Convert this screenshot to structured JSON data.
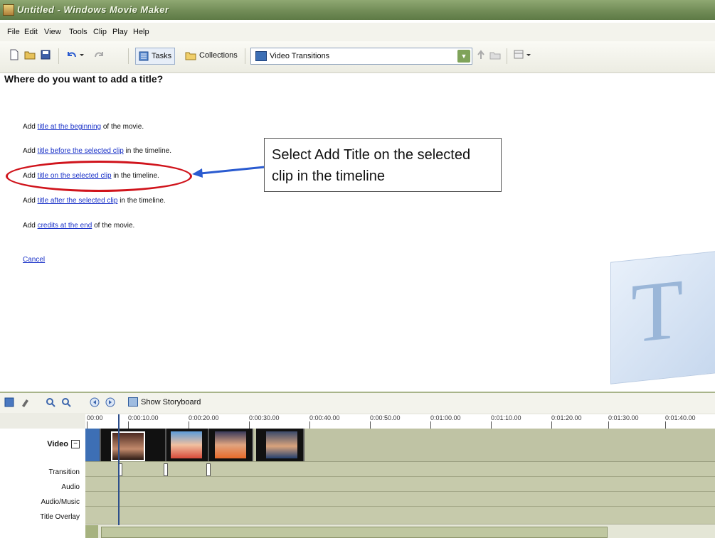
{
  "window": {
    "title": "Untitled - Windows Movie Maker"
  },
  "menu": [
    "File",
    "Edit",
    "View",
    "Tools",
    "Clip",
    "Play",
    "Help"
  ],
  "toolbar": {
    "tasks_label": "Tasks",
    "collections_label": "Collections",
    "dropdown_value": "Video Transitions"
  },
  "main": {
    "heading": "Where do you want to add a title?",
    "options": [
      {
        "prefix": "Add ",
        "link": "title at the beginning",
        "suffix": " of the movie."
      },
      {
        "prefix": "Add ",
        "link": "title before the selected clip",
        "suffix": " in the timeline."
      },
      {
        "prefix": "Add ",
        "link": "title on the selected clip",
        "suffix": " in the timeline."
      },
      {
        "prefix": "Add ",
        "link": "title after the selected clip",
        "suffix": " in the timeline."
      },
      {
        "prefix": "Add ",
        "link": "credits at the end",
        "suffix": " of the movie."
      }
    ],
    "cancel_label": "Cancel",
    "callout_text": "Select Add Title on the selected clip in the timeline",
    "watermark_letter": "T"
  },
  "timeline": {
    "show_storyboard_label": "Show Storyboard",
    "ruler_ticks": [
      "00:00",
      "0:00:10.00",
      "0:00:20.00",
      "0:00:30.00",
      "0:00:40.00",
      "0:00:50.00",
      "0:01:00.00",
      "0:01:10.00",
      "0:01:20.00",
      "0:01:30.00",
      "0:01:40.00"
    ],
    "tracks": {
      "video": "Video",
      "transition": "Transition",
      "audio": "Audio",
      "audio_music": "Audio/Music",
      "title_overlay": "Title Overlay"
    }
  },
  "colors": {
    "titlebar": "#6f8a55",
    "link": "#1a32c8",
    "highlight": "#d0141c",
    "arrow": "#2a5bd0"
  }
}
